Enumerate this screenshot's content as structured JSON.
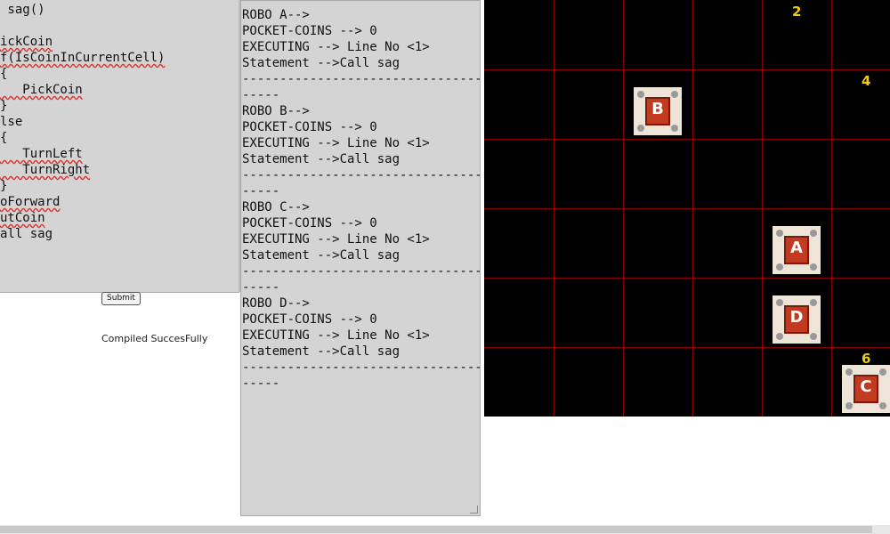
{
  "editor": {
    "lines": [
      " sag()",
      "",
      "ickCoin",
      "f(IsCoinInCurrentCell)",
      "",
      "   PickCoin",
      "",
      "lse",
      "",
      "   TurnLeft",
      "   TurnRight",
      "",
      "oForward",
      "utCoin",
      "all sag"
    ]
  },
  "submit_label": "Submit",
  "status": "Compiled SuccesFully",
  "console": {
    "lines": [
      "ROBO A-->",
      "POCKET-COINS --> 0",
      "EXECUTING --> Line No <1>",
      "Statement -->Call sag",
      "----------------------------------",
      "-----",
      "ROBO B-->",
      "POCKET-COINS --> 0",
      "EXECUTING --> Line No <1>",
      "Statement -->Call sag",
      "----------------------------------",
      "-----",
      "ROBO C-->",
      "POCKET-COINS --> 0",
      "EXECUTING --> Line No <1>",
      "Statement -->Call sag",
      "----------------------------------",
      "-----",
      "ROBO D-->",
      "POCKET-COINS --> 0",
      "EXECUTING --> Line No <1>",
      "Statement -->Call sag",
      "----------------------------------",
      "-----"
    ]
  },
  "grid": {
    "coins": [
      {
        "value": "2",
        "row": 0,
        "col": 4
      },
      {
        "value": "4",
        "row": 1,
        "col": 5
      },
      {
        "value": "6",
        "row": 5,
        "col": 5
      }
    ],
    "robots": [
      {
        "letter": "B",
        "row": 1,
        "col": 2
      },
      {
        "letter": "A",
        "row": 3,
        "col": 4
      },
      {
        "letter": "D",
        "row": 4,
        "col": 4
      },
      {
        "letter": "C",
        "row": 5,
        "col": 5
      }
    ],
    "colors": {
      "background": "#000000",
      "lines": "#8b0000",
      "coin": "#f5d000",
      "robot": "#c23a1f"
    }
  }
}
